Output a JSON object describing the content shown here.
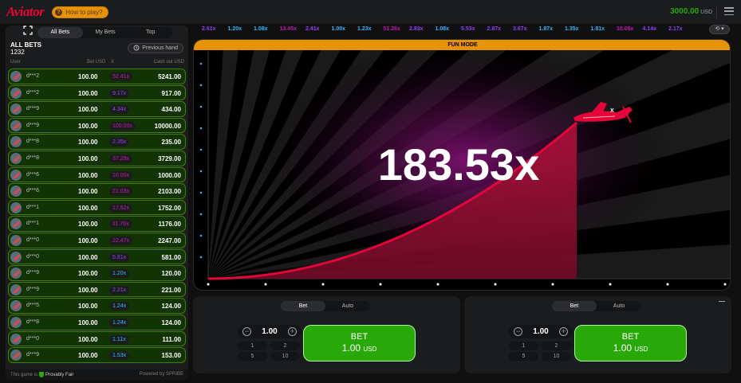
{
  "header": {
    "logo": "Aviator",
    "how_to_play": "How to play?",
    "balance": "3000.00",
    "currency": "USD"
  },
  "left_panel": {
    "tabs": [
      "All Bets",
      "My Bets",
      "Top"
    ],
    "title": "ALL BETS",
    "count": "1232",
    "previous_hand": "Previous hand",
    "columns": {
      "user": "User",
      "bet": "Bet USD",
      "x": "X",
      "cashout": "Cash out USD"
    },
    "rows": [
      {
        "user": "d***2",
        "bet": "100.00",
        "mult": "52.41x",
        "mult_color": "#c017b4",
        "cash": "5241.00"
      },
      {
        "user": "d***2",
        "bet": "100.00",
        "mult": "9.17x",
        "mult_color": "#913ef8",
        "cash": "917.00"
      },
      {
        "user": "d***9",
        "bet": "100.00",
        "mult": "4.34x",
        "mult_color": "#913ef8",
        "cash": "434.00"
      },
      {
        "user": "d***9",
        "bet": "100.00",
        "mult": "100.00x",
        "mult_color": "#c017b4",
        "cash": "10000.00"
      },
      {
        "user": "d***8",
        "bet": "100.00",
        "mult": "2.35x",
        "mult_color": "#913ef8",
        "cash": "235.00"
      },
      {
        "user": "d***8",
        "bet": "100.00",
        "mult": "37.29x",
        "mult_color": "#c017b4",
        "cash": "3729.00"
      },
      {
        "user": "d***6",
        "bet": "100.00",
        "mult": "10.00x",
        "mult_color": "#c017b4",
        "cash": "1000.00"
      },
      {
        "user": "d***6",
        "bet": "100.00",
        "mult": "21.03x",
        "mult_color": "#c017b4",
        "cash": "2103.00"
      },
      {
        "user": "d***1",
        "bet": "100.00",
        "mult": "17.52x",
        "mult_color": "#c017b4",
        "cash": "1752.00"
      },
      {
        "user": "d***1",
        "bet": "100.00",
        "mult": "11.76x",
        "mult_color": "#c017b4",
        "cash": "1176.00"
      },
      {
        "user": "d***0",
        "bet": "100.00",
        "mult": "22.47x",
        "mult_color": "#c017b4",
        "cash": "2247.00"
      },
      {
        "user": "d***0",
        "bet": "100.00",
        "mult": "5.81x",
        "mult_color": "#913ef8",
        "cash": "581.00"
      },
      {
        "user": "d***9",
        "bet": "100.00",
        "mult": "1.20x",
        "mult_color": "#34b4ff",
        "cash": "120.00"
      },
      {
        "user": "d***9",
        "bet": "100.00",
        "mult": "2.21x",
        "mult_color": "#913ef8",
        "cash": "221.00"
      },
      {
        "user": "d***5",
        "bet": "100.00",
        "mult": "1.24x",
        "mult_color": "#34b4ff",
        "cash": "124.00"
      },
      {
        "user": "d***8",
        "bet": "100.00",
        "mult": "1.24x",
        "mult_color": "#34b4ff",
        "cash": "124.00"
      },
      {
        "user": "d***0",
        "bet": "100.00",
        "mult": "1.11x",
        "mult_color": "#34b4ff",
        "cash": "111.00"
      },
      {
        "user": "d***9",
        "bet": "100.00",
        "mult": "1.53x",
        "mult_color": "#34b4ff",
        "cash": "153.00"
      }
    ],
    "footer_pf_prefix": "This game is",
    "footer_pf": "Provably Fair",
    "footer_powered": "Powered by SPRIBE"
  },
  "history": [
    {
      "v": "2.61x",
      "c": "#913ef8"
    },
    {
      "v": "1.20x",
      "c": "#34b4ff"
    },
    {
      "v": "1.08x",
      "c": "#34b4ff"
    },
    {
      "v": "13.45x",
      "c": "#c017b4"
    },
    {
      "v": "2.41x",
      "c": "#913ef8"
    },
    {
      "v": "1.00x",
      "c": "#34b4ff"
    },
    {
      "v": "1.23x",
      "c": "#34b4ff"
    },
    {
      "v": "51.26x",
      "c": "#c017b4"
    },
    {
      "v": "2.83x",
      "c": "#913ef8"
    },
    {
      "v": "1.08x",
      "c": "#34b4ff"
    },
    {
      "v": "5.53x",
      "c": "#913ef8"
    },
    {
      "v": "2.87x",
      "c": "#913ef8"
    },
    {
      "v": "3.67x",
      "c": "#913ef8"
    },
    {
      "v": "1.87x",
      "c": "#34b4ff"
    },
    {
      "v": "1.35x",
      "c": "#34b4ff"
    },
    {
      "v": "1.81x",
      "c": "#34b4ff"
    },
    {
      "v": "10.08x",
      "c": "#c017b4"
    },
    {
      "v": "4.14x",
      "c": "#913ef8"
    },
    {
      "v": "2.17x",
      "c": "#913ef8"
    }
  ],
  "game": {
    "mode_banner": "FUN MODE",
    "multiplier": "183.53x"
  },
  "bet_panels": [
    {
      "tabs": [
        "Bet",
        "Auto"
      ],
      "stake": "1.00",
      "quick": [
        "1",
        "2",
        "5",
        "10"
      ],
      "bet_label": "BET",
      "bet_amount": "1.00",
      "bet_currency": "USD"
    },
    {
      "tabs": [
        "Bet",
        "Auto"
      ],
      "stake": "1.00",
      "quick": [
        "1",
        "2",
        "5",
        "10"
      ],
      "bet_label": "BET",
      "bet_amount": "1.00",
      "bet_currency": "USD"
    }
  ]
}
